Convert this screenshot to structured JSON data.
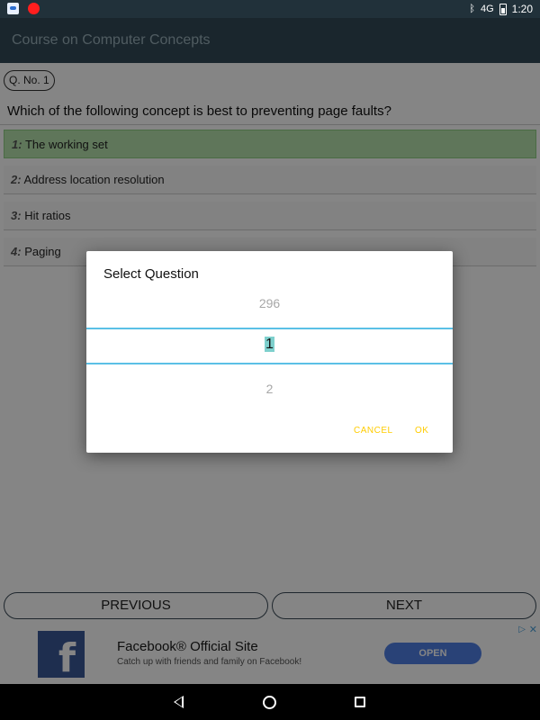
{
  "status_bar": {
    "time": "1:20",
    "network": "4G"
  },
  "app_bar": {
    "title": "Course on Computer Concepts"
  },
  "question": {
    "number_label": "Q. No. 1",
    "text": "Which of the following concept is best to preventing page faults?",
    "options": [
      {
        "num": "1",
        "text": "The working set"
      },
      {
        "num": "2",
        "text": "Address location resolution"
      },
      {
        "num": "3",
        "text": "Hit ratios"
      },
      {
        "num": "4",
        "text": "Paging"
      }
    ]
  },
  "nav_buttons": {
    "previous": "PREVIOUS",
    "next": "NEXT"
  },
  "ad": {
    "title": "Facebook® Official Site",
    "subtitle": "Catch up with friends and family on Facebook!",
    "cta": "OPEN",
    "choices_icon": "▷",
    "close_icon": "✕"
  },
  "dialog": {
    "title": "Select Question",
    "picker_prev": "296",
    "picker_selected": "1",
    "picker_next": "2",
    "cancel": "CANCEL",
    "ok": "OK"
  },
  "colors": {
    "accent": "#ffcc00",
    "picker_line": "#5bc0e6",
    "correct_option": "#b6e3ad",
    "app_bar": "#324a56",
    "ad_button": "#4f7fe4"
  }
}
